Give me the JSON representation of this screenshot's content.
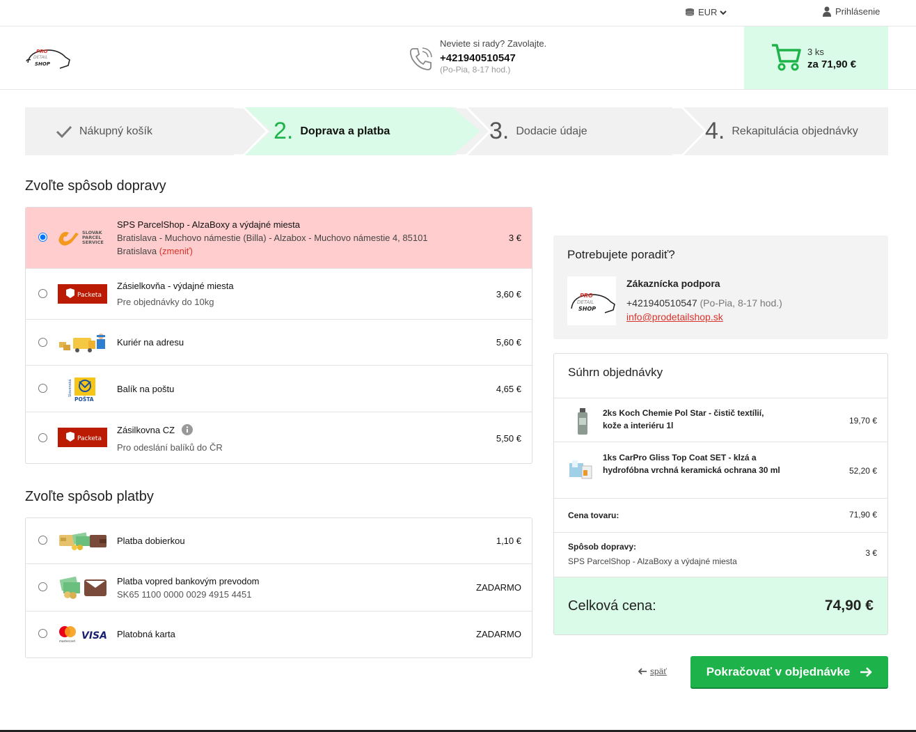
{
  "topbar": {
    "currency": "EUR",
    "login": "Prihlásenie"
  },
  "header": {
    "logo_text": [
      "PRO",
      "DETAIL",
      "SHOP"
    ],
    "phone_hint": "Neviete si rady? Zavolajte.",
    "phone": "+421940510547",
    "hours": "(Po-Pia, 8-17 hod.)",
    "cart_qty": "3 ks",
    "cart_total": "za 71,90 €"
  },
  "steps": [
    {
      "num": "",
      "label": "Nákupný košík"
    },
    {
      "num": "2.",
      "label": "Doprava a platba"
    },
    {
      "num": "3.",
      "label": "Dodacie údaje"
    },
    {
      "num": "4.",
      "label": "Rekapitulácia objednávky"
    }
  ],
  "shipping": {
    "heading": "Zvoľte spôsob dopravy",
    "options": [
      {
        "name": "SPS ParcelShop - AlzaBoxy a výdajné miesta",
        "sub1": "Bratislava - Muchovo námestie (Billa) - Alzabox - Muchovo námestie 4, 85101",
        "sub2": "Bratislava",
        "change": "(zmeniť)",
        "price": "3 €",
        "logo": "sps-logo",
        "logo_text": [
          "SLOVAK",
          "PARCEL",
          "SERVICE"
        ]
      },
      {
        "name": "Zásielkovňa - výdajné miesta",
        "sub1": "Pre objednávky do 10kg",
        "price": "3,60 €",
        "logo": "packeta-logo",
        "logo_text": "Packeta"
      },
      {
        "name": "Kuriér na adresu",
        "price": "5,60 €",
        "logo": "courier-logo"
      },
      {
        "name": "Balík na poštu",
        "price": "4,65 €",
        "logo": "posta-logo",
        "logo_text": [
          "Slovenská",
          "POŠTA"
        ]
      },
      {
        "name": "Zásilkovna CZ",
        "sub1": "Pro odeslání balíků do ČR",
        "price": "5,50 €",
        "logo": "packeta-logo",
        "logo_text": "Packeta"
      }
    ]
  },
  "payment": {
    "heading": "Zvoľte spôsob platby",
    "options": [
      {
        "name": "Platba dobierkou",
        "price": "1,10 €",
        "logo": "cash-logo"
      },
      {
        "name": "Platba vopred bankovým prevodom",
        "sub1": "SK65 1100 0000 0029 4915 4451",
        "price": "ZADARMO",
        "logo": "bank-logo"
      },
      {
        "name": "Platobná karta",
        "price": "ZADARMO",
        "logo": "card-logo",
        "logo_text": [
          "mastercard",
          "VISA"
        ]
      }
    ]
  },
  "advice": {
    "title": "Potrebujete poradiť?",
    "name": "Zákaznícka podpora",
    "phone": "+421940510547",
    "hours": "(Po-Pia, 8-17 hod.)",
    "email": "info@prodetailshop.sk"
  },
  "summary": {
    "title": "Súhrn objednávky",
    "items": [
      {
        "text": "2ks Koch Chemie Pol Star - čistič textílií, kože a interiéru 1l",
        "price": "19,70 €"
      },
      {
        "text": "1ks CarPro Gliss Top Coat SET - klzá a hydrofóbna vrchná keramická ochrana 30 ml",
        "price": "52,20 €"
      }
    ],
    "goods_label": "Cena tovaru:",
    "goods_price": "71,90 €",
    "ship_label": "Spôsob dopravy:",
    "ship_name": "SPS ParcelShop - AlzaBoxy a výdajné miesta",
    "ship_price": "3 €",
    "total_label": "Celková cena:",
    "total_price": "74,90 €"
  },
  "actions": {
    "back": "späť",
    "continue": "Pokračovať v objednávke"
  },
  "colors": {
    "accent_green": "#1db34a",
    "light_green": "#d9fbe7",
    "selected_red": "#ffcdcd",
    "link_red": "#d9322b"
  }
}
